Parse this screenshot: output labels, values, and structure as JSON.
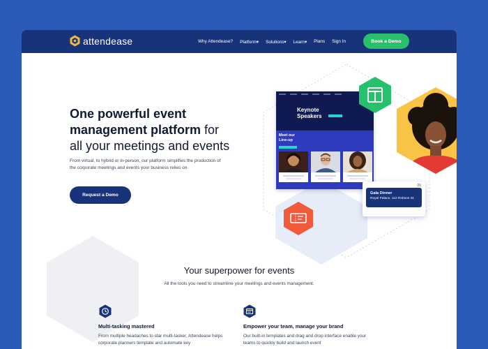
{
  "colors": {
    "background": "#2c5ab8",
    "navbar": "#17337a",
    "accent_green": "#27c16b",
    "accent_orange": "#f15a3b",
    "accent_yellow": "#f9c446",
    "primary": "#17337a"
  },
  "brand": {
    "name": "attendease",
    "logo_icon": "hexagon-logo-icon"
  },
  "nav": {
    "links": [
      "Why Attendease?",
      "Platform▾",
      "Solutions▾",
      "Learn▾",
      "Plans",
      "Sign In"
    ],
    "cta": "Book a Demo"
  },
  "hero": {
    "title_bold_1": "One powerful event",
    "title_bold_2": "management platform",
    "title_light_1": " for",
    "title_light_2": "all your meetings and events",
    "subtitle": "From virtual, to hybrid or in-person, our platform simplifies the production of the corporate meetings and events your business relies on.",
    "cta": "Request a Demo"
  },
  "mockup": {
    "keynote_title": "Keynote Speakers",
    "lineup_title": "Meet our Line-up",
    "layout_icon": "layout-icon",
    "ticket_icon": "ticket-icon"
  },
  "gala": {
    "date": "05",
    "name": "Gala Dinner",
    "place": "Royal Palace, 112 Robson St."
  },
  "features_section": {
    "title": "Your superpower for events",
    "subtitle": "All the tools you need to streamline your meetings and events management.",
    "items": [
      {
        "icon": "clock-icon",
        "title": "Multi-tasking mastered",
        "desc": "From multiple headaches to star multi-tasker, Attendease helps corporate planners template and automate key"
      },
      {
        "icon": "browser-icon",
        "title": "Empower your team, manage your brand",
        "desc": "Our built-in templates and drag and drop interface enable your teams to quickly build and launch event"
      }
    ]
  }
}
